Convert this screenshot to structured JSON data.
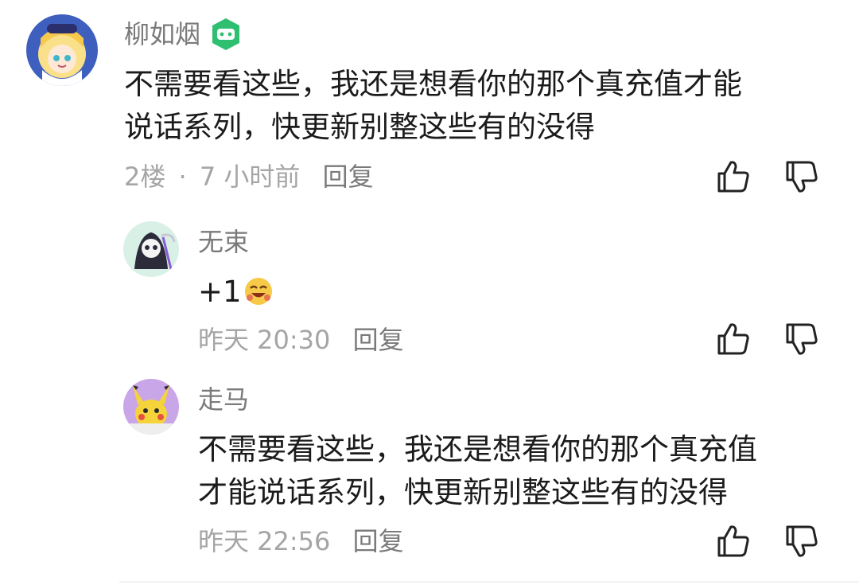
{
  "comments": [
    {
      "username": "柳如烟",
      "text_lines": [
        "不需要看这些，我还是想看你的那个真充值才能",
        "说话系列，快更新别整这些有的没得"
      ],
      "floor": "2楼",
      "separator": "·",
      "time": "7 小时前",
      "reply_label": "回复",
      "has_badge": true
    }
  ],
  "replies": [
    {
      "username": "无束",
      "text": "+1",
      "has_emoji": true,
      "time": "昨天 20:30",
      "reply_label": "回复"
    },
    {
      "username": "走马",
      "text_lines": [
        "不需要看这些，我还是想看你的那个真充值",
        "才能说话系列，快更新别整这些有的没得"
      ],
      "time": "昨天 22:56",
      "reply_label": "回复"
    }
  ],
  "icons": {
    "like": "thumbs-up-icon",
    "dislike": "thumbs-down-icon",
    "badge": "game-controller-badge-icon"
  },
  "colors": {
    "badge_green": "#2fbf71",
    "meta_gray": "#a5a5a5",
    "name_gray": "#7a7a7a"
  }
}
